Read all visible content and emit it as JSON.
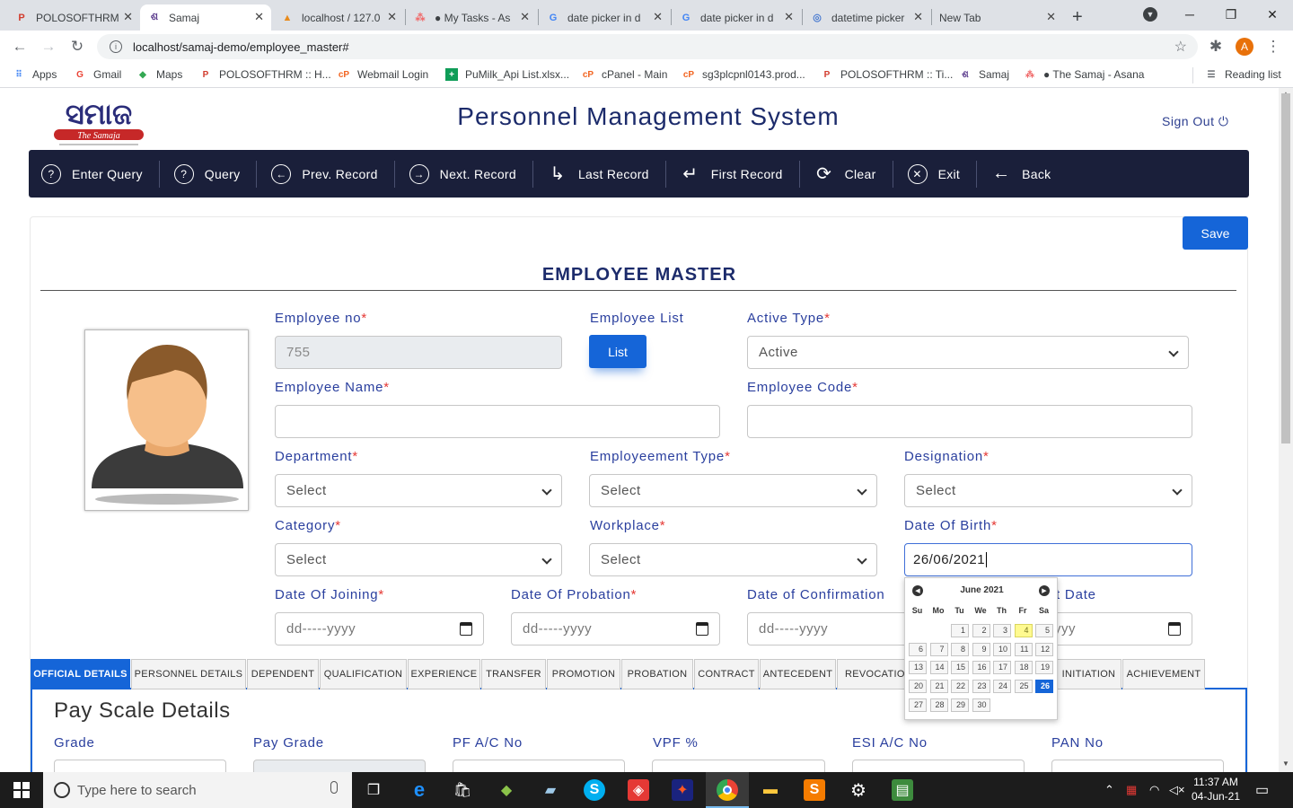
{
  "browser": {
    "tabs": [
      {
        "title": "POLOSOFTHRM",
        "icon": "P"
      },
      {
        "title": "Samaj",
        "icon": "S"
      },
      {
        "title": "localhost / 127.0",
        "icon": "pma"
      },
      {
        "title": "● My Tasks - As",
        "icon": "asana"
      },
      {
        "title": "date picker in d",
        "icon": "G"
      },
      {
        "title": "date picker in d",
        "icon": "G"
      },
      {
        "title": "datetime picker",
        "icon": "dt"
      },
      {
        "title": "New Tab",
        "icon": ""
      }
    ],
    "new_tab": "+",
    "url": "localhost/samaj-demo/employee_master#",
    "profile_initial": "A",
    "bookmarks": [
      {
        "label": "Apps"
      },
      {
        "label": "Gmail"
      },
      {
        "label": "Maps"
      },
      {
        "label": "POLOSOFTHRM :: H..."
      },
      {
        "label": "Webmail Login"
      },
      {
        "label": "PuMilk_Api List.xlsx..."
      },
      {
        "label": "cPanel - Main"
      },
      {
        "label": "sg3plcpnl0143.prod..."
      },
      {
        "label": "POLOSOFTHRM :: Ti..."
      },
      {
        "label": "Samaj"
      },
      {
        "label": "● The Samaj - Asana"
      }
    ],
    "reading_list": "Reading list"
  },
  "header": {
    "title": "Personnel Management System",
    "sign_out": "Sign Out",
    "logo_text": "ସମାଜ",
    "logo_sub": "The Samaja"
  },
  "menu": [
    {
      "label": "Enter Query",
      "icon": "?"
    },
    {
      "label": "Query",
      "icon": "?"
    },
    {
      "label": "Prev. Record",
      "icon": "←"
    },
    {
      "label": "Next. Record",
      "icon": "→"
    },
    {
      "label": "Last Record",
      "icon": "↳"
    },
    {
      "label": "First Record",
      "icon": "↵"
    },
    {
      "label": "Clear",
      "icon": "⟳"
    },
    {
      "label": "Exit",
      "icon": "✕"
    },
    {
      "label": "Back",
      "icon": "←"
    }
  ],
  "form": {
    "save": "Save",
    "title": "EMPLOYEE MASTER",
    "employee_no": {
      "label": "Employee no",
      "value": "755"
    },
    "employee_list": {
      "label": "Employee List",
      "button": "List"
    },
    "active_type": {
      "label": "Active Type",
      "value": "Active"
    },
    "employee_name": {
      "label": "Employee Name",
      "value": ""
    },
    "employee_code": {
      "label": "Employee Code",
      "value": ""
    },
    "department": {
      "label": "Department",
      "value": "Select"
    },
    "employment_type": {
      "label": "Employeement Type",
      "value": "Select"
    },
    "designation": {
      "label": "Designation",
      "value": "Select"
    },
    "category": {
      "label": "Category",
      "value": "Select"
    },
    "workplace": {
      "label": "Workplace",
      "value": "Select"
    },
    "dob": {
      "label": "Date Of Birth",
      "value": "26/06/2021"
    },
    "doj": {
      "label": "Date Of Joining",
      "value": "dd-----yyyy"
    },
    "dop": {
      "label": "Date Of Probation",
      "value": "dd-----yyyy"
    },
    "doc": {
      "label": "Date of Confirmation",
      "value": "dd-----yyyy"
    },
    "dort": {
      "label": "t Date",
      "value": "yyy"
    },
    "required_mark": "*"
  },
  "tabs": [
    {
      "label": "OFFICIAL DETAILS"
    },
    {
      "label": "PERSONNEL DETAILS"
    },
    {
      "label": "DEPENDENT"
    },
    {
      "label": "QUALIFICATION"
    },
    {
      "label": "EXPERIENCE"
    },
    {
      "label": "TRANSFER"
    },
    {
      "label": "PROMOTION"
    },
    {
      "label": "PROBATION"
    },
    {
      "label": "CONTRACT"
    },
    {
      "label": "ANTECEDENT"
    },
    {
      "label": "REVOCATION"
    },
    {
      "label": "INITIATION"
    },
    {
      "label": "ACHIEVEMENT"
    }
  ],
  "pay_scale": {
    "heading": "Pay Scale Details",
    "fields": [
      {
        "label": "Grade"
      },
      {
        "label": "Pay Grade"
      },
      {
        "label": "PF A/C No"
      },
      {
        "label": "VPF %"
      },
      {
        "label": "ESI A/C No"
      },
      {
        "label": "PAN No"
      }
    ]
  },
  "datepicker": {
    "month": "June 2021",
    "dow": [
      "Su",
      "Mo",
      "Tu",
      "We",
      "Th",
      "Fr",
      "Sa"
    ],
    "first_weekday": 2,
    "days_in_month": 30,
    "today": 4,
    "selected": 26
  },
  "taskbar": {
    "search_placeholder": "Type here to search",
    "time": "11:37 AM",
    "date": "04-Jun-21"
  },
  "colors": {
    "accent": "#1565d8",
    "menubar": "#1a1f3a",
    "label": "#2a3f9e",
    "required": "#e53935"
  }
}
